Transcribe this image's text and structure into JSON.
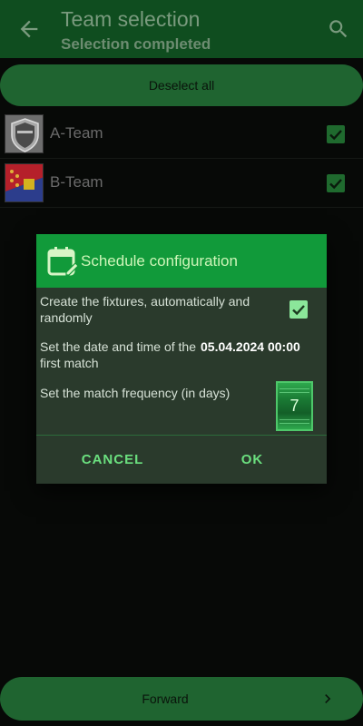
{
  "appbar": {
    "title": "Team selection",
    "subtitle": "Selection completed",
    "back_icon": "arrow-left-icon",
    "search_icon": "search-icon"
  },
  "deselect_label": "Deselect all",
  "teams": [
    {
      "name": "A-Team",
      "checked": true,
      "logo": "shield-logo"
    },
    {
      "name": "B-Team",
      "checked": true,
      "logo": "flag-logo"
    }
  ],
  "forward_label": "Forward",
  "dialog": {
    "title": "Schedule configuration",
    "title_icon": "calendar-edit-icon",
    "auto_fixtures_label": "Create the fixtures, automatically and randomly",
    "auto_fixtures_checked": true,
    "first_match_label": "Set the date and time of the first match",
    "first_match_value": "05.04.2024 00:00",
    "frequency_label": "Set the match frequency (in days)",
    "frequency_value": "7",
    "cancel_label": "CANCEL",
    "ok_label": "OK"
  },
  "colors": {
    "appbar": "#0f4d1f",
    "dialog_header": "#119a3a",
    "dialog_body": "#2a3a2c",
    "accent": "#6be07f"
  }
}
